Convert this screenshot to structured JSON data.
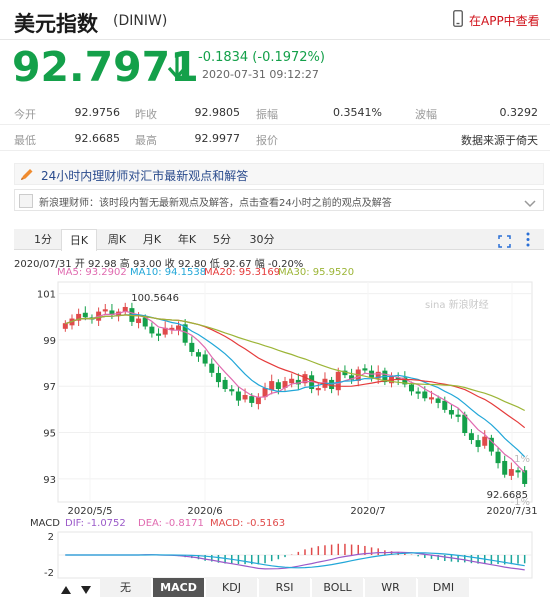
{
  "header": {
    "title": "美元指数",
    "code": "(DINIW)",
    "app_link": "在APP中查看"
  },
  "quote": {
    "price": "92.7971",
    "change": "-0.1834 (-0.1972%)",
    "datetime": "2020-07-31 09:12:27",
    "down_color": "#14a04a",
    "icon": "arrow-down-icon"
  },
  "stats": {
    "row1": [
      {
        "label": "今开",
        "value": "92.9756"
      },
      {
        "label": "昨收",
        "value": "92.9805"
      },
      {
        "label": "振幅",
        "value": "0.3541%"
      },
      {
        "label": "波幅",
        "value": "0.3292"
      }
    ],
    "row2": [
      {
        "label": "最低",
        "value": "92.6685"
      },
      {
        "label": "最高",
        "value": "92.9977"
      },
      {
        "label": "报价",
        "value": ""
      },
      {
        "label": "",
        "value": "数据来源于倚天"
      }
    ]
  },
  "advice": {
    "heading": "24小时内理财师对汇市最新观点和解答",
    "message": "新浪理财师：该时段内暂无最新观点及解答，点击查看24小时之前的观点及解答"
  },
  "tabs": {
    "items": [
      "1分",
      "日K",
      "周K",
      "月K",
      "年K",
      "5分",
      "30分"
    ],
    "active": "日K"
  },
  "chart_info": {
    "ohlc_line": "2020/07/31 开 92.98 高 93.00 收 92.80 低 92.67 幅 -0.20%",
    "ma5": "MA5: 93.2902",
    "ma10": "MA10: 94.1538",
    "ma20": "MA20: 95.3169",
    "ma30": "MA30: 95.9520",
    "watermark": "sina 新浪财经",
    "macd_line": {
      "label": "MACD",
      "dif": "DIF: -1.0752",
      "dea": "DEA: -0.8171",
      "macd": "MACD: -0.5163"
    }
  },
  "chart_data": {
    "type": "candlestick",
    "title": "",
    "y_ticks": [
      "101",
      "99",
      "97",
      "95",
      "93"
    ],
    "pct_ticks": [
      "1%",
      "-1%",
      "-3%",
      "-5%",
      "-7%"
    ],
    "x_ticks": [
      "2020/5/5",
      "2020/6",
      "2020/7",
      "2020/7/31"
    ],
    "ylim": [
      92.0,
      101.5
    ],
    "annotations": {
      "high": "100.5646",
      "low": "92.6685"
    },
    "macd_ticks": [
      "2",
      "-2"
    ],
    "close": [
      99.7,
      99.9,
      100.1,
      100.0,
      99.9,
      100.2,
      100.3,
      100.1,
      100.2,
      100.4,
      99.8,
      99.9,
      99.6,
      99.3,
      99.2,
      99.5,
      99.5,
      99.6,
      98.9,
      98.5,
      98.3,
      98.0,
      97.6,
      97.2,
      96.9,
      96.8,
      96.4,
      96.6,
      96.3,
      96.5,
      96.9,
      97.2,
      96.9,
      97.2,
      97.3,
      97.1,
      97.5,
      96.9,
      96.9,
      97.3,
      96.9,
      97.6,
      97.5,
      97.3,
      97.7,
      97.7,
      97.4,
      97.6,
      97.2,
      97.4,
      97.3,
      97.1,
      96.8,
      96.7,
      96.5,
      96.5,
      96.3,
      96.0,
      95.8,
      95.7,
      95.0,
      94.7,
      94.4,
      94.8,
      94.2,
      93.7,
      93.2,
      93.4,
      93.3,
      92.8
    ],
    "ma5": [
      93.29
    ],
    "ma10": [
      94.15
    ],
    "ma20": [
      95.32
    ],
    "ma30": [
      95.95
    ],
    "colors": {
      "up": "#e04b4b",
      "down": "#14a04a",
      "ma5": "#e06bb0",
      "ma10": "#22a7d8",
      "ma20": "#e53b3b",
      "ma30": "#9cb537"
    }
  },
  "bottom_tabs": {
    "items": [
      "无",
      "MACD",
      "KDJ",
      "RSI",
      "BOLL",
      "WR",
      "DMI"
    ],
    "active": "MACD"
  }
}
